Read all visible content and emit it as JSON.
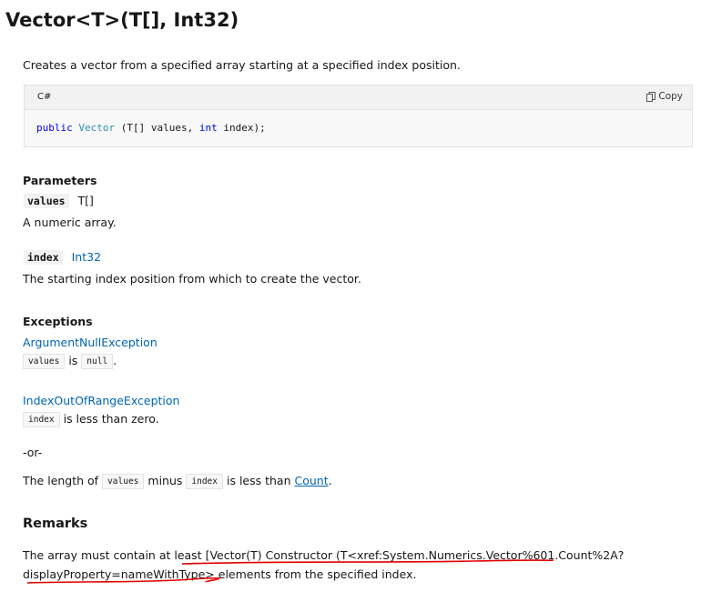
{
  "title": "Vector<T>(T[], Int32)",
  "description": "Creates a vector from a specified array starting at a specified index position.",
  "code": {
    "language": "C#",
    "copy_label": "Copy",
    "kw_public": "public",
    "ctor_name": "Vector",
    "open": " (T[] values, ",
    "kw_int": "int",
    "close": " index);"
  },
  "parameters": {
    "heading": "Parameters",
    "items": [
      {
        "name": "values",
        "type": "T[]",
        "description": "A numeric array."
      },
      {
        "name": "index",
        "type": "Int32",
        "description": "The starting index position from which to create the vector."
      }
    ]
  },
  "exceptions": {
    "heading": "Exceptions",
    "items": [
      {
        "name": "ArgumentNullException",
        "code1": "values",
        "mid": "is",
        "code2": "null",
        "end": "."
      },
      {
        "name": "IndexOutOfRangeException",
        "code1": "index",
        "rest": "is less than zero.",
        "or": "-or-",
        "length_prefix": "The length of",
        "code2": "values",
        "minus": "minus",
        "code3": "index",
        "less_than": "is less than",
        "count_link": "Count",
        "period": "."
      }
    ]
  },
  "remarks": {
    "heading": "Remarks",
    "line1_prefix": "The array must contain at least ",
    "line1_broken": "[Vector(T) Constructor (T<xref:System.Numerics.Vector%601.Count%2A?",
    "line2_broken": "displayProperty=nameWithType>",
    "line2_suffix": " elements from the specified index."
  },
  "annotation_color": "#e00000"
}
